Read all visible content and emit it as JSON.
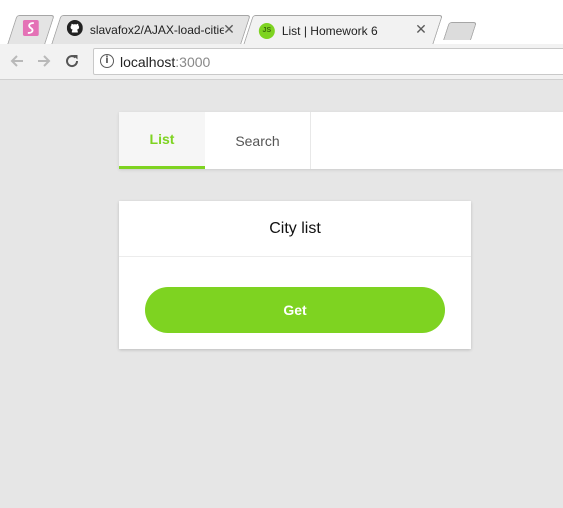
{
  "browser": {
    "tabs": [
      {
        "title": "",
        "icon": "app-favicon-icon",
        "active": false
      },
      {
        "title": "slavafox2/AJAX-load-citie",
        "icon": "github-icon",
        "active": false
      },
      {
        "title": "List | Homework 6",
        "icon": "js-favicon-icon",
        "favicon_text": "JS",
        "active": true
      }
    ],
    "close_glyph": "✕",
    "address": {
      "host": "localhost",
      "port": ":3000",
      "info_glyph": "i"
    }
  },
  "page": {
    "nav": [
      {
        "label": "List",
        "active": true
      },
      {
        "label": "Search",
        "active": false
      }
    ],
    "card": {
      "title": "City list",
      "button_label": "Get"
    }
  },
  "colors": {
    "accent": "#7ed321",
    "page_background": "#e6e6e6",
    "favicon_pink": "#e472b6",
    "js_favicon": "#7ed321"
  }
}
